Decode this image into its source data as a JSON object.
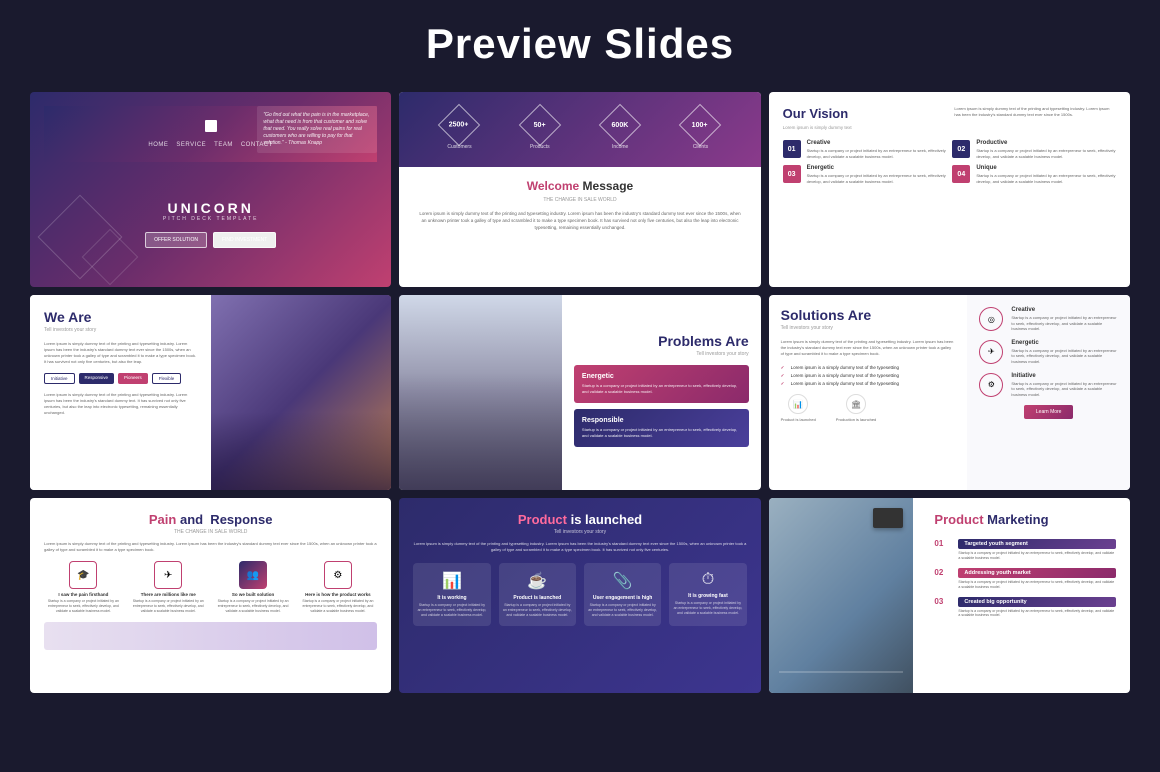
{
  "page": {
    "title": "Preview Slides",
    "background": "#1a1a2e"
  },
  "slides": [
    {
      "id": "slide-1",
      "type": "unicorn",
      "brand": "UNICORN",
      "subtitle": "PITCH DECK TEMPLATE",
      "quote": "\"Go find out what the pain is in the marketplace, what that need is from that customer and solve that need. You really solve real pains for real customers who are willing to pay for that solution.\" - Thomas Knapp",
      "nav": [
        "HOME",
        "SERVICE",
        "TEAM",
        "CONTACT"
      ],
      "btn1": "OFFER SOLUTION",
      "btn2": "FIND INVESTMENT"
    },
    {
      "id": "slide-2",
      "type": "welcome",
      "stats": [
        {
          "num": "2500+",
          "label": "Customers"
        },
        {
          "num": "50+",
          "label": "Products"
        },
        {
          "num": "600K",
          "label": "Income"
        },
        {
          "num": "100+",
          "label": "Clients"
        }
      ],
      "title": "Welcome Message",
      "title_highlight": "Welcome",
      "subtitle": "THE CHANGE IN SALE WORLD",
      "desc": "Lorem ipsum is simply dummy text of the printing and typesetting industry. Lorem ipsum has been the industry's standard dummy text ever since the 1500s, when an unknown printer took a galley of type and scrambled it to make a type specimen book. It has survived not only five centuries, but also the leap into electronic typesetting, remaining essentially unchanged."
    },
    {
      "id": "slide-3",
      "type": "vision",
      "title": "Our Vision",
      "items": [
        {
          "num": "01",
          "label": "Creative",
          "desc": "Startup is a company or project initiated by an entrepreneur to seek, effectively develop, and validate a scalable business model."
        },
        {
          "num": "02",
          "label": "Productive",
          "desc": "Startup is a company or project initiated by an entrepreneur to seek, effectively develop, and validate a scalable business model."
        },
        {
          "num": "03",
          "label": "Energetic",
          "desc": "Startup is a company or project initiated by an entrepreneur to seek, effectively develop, and validate a scalable business model."
        },
        {
          "num": "04",
          "label": "Unique",
          "desc": "Startup is a company or project initiated by an entrepreneur to seek, effectively develop, and validate a scalable business model."
        }
      ]
    },
    {
      "id": "slide-4",
      "type": "we-are",
      "title": "We Are",
      "subtitle": "Tell investors your story",
      "desc": "Lorem ipsum is simply dummy text of the printing and typesetting industry.",
      "tags": [
        "Initiative",
        "Responsive",
        "Pioneers",
        "Flexible"
      ]
    },
    {
      "id": "slide-5",
      "type": "problems",
      "title": "Problems Are",
      "subtitle": "Tell investors your story",
      "cards": [
        {
          "title": "Energetic",
          "desc": "Startup is a company or project initiated by an entrepreneur to seek, effectively develop, and validate a scalable business model.",
          "style": "pink"
        },
        {
          "title": "Responsible",
          "desc": "Startup is a company or project initiated by an entrepreneur to seek, effectively develop, and validate a scalable business model.",
          "style": "dark"
        }
      ]
    },
    {
      "id": "slide-6",
      "type": "solutions",
      "title": "Solutions Are",
      "subtitle": "Tell investors your story",
      "checklist": [
        "Lorem ipsum is a simply dummy text of the typesetting",
        "Lorem ipsum is a simply dummy text of the typesetting",
        "Lorem ipsum is a simply dummy text of the typesetting"
      ],
      "items": [
        {
          "icon": "◎",
          "title": "Creative",
          "desc": "Startup is a company or project initiated by an entrepreneur to seek, effectively develop, and validate a scalable business model."
        },
        {
          "icon": "✈",
          "title": "Energetic",
          "desc": "Startup is a company or project initiated by an entrepreneur to seek, effectively develop, and validate a scalable business model."
        },
        {
          "icon": "⚙",
          "title": "Initiative",
          "desc": "Startup is a company or project initiated by an entrepreneur to seek, effectively develop, and validate a scalable business model."
        }
      ],
      "learn_btn": "Learn More",
      "bottom_icons": [
        {
          "icon": "📊",
          "label": "Product is launched"
        },
        {
          "icon": "🏛",
          "label": "Production is launched"
        }
      ]
    },
    {
      "id": "slide-7",
      "type": "pain",
      "title": "Pain and  Response",
      "title_highlight": "Pain",
      "subtitle": "THE CHANGE IN SALE WORLD",
      "desc": "Lorem ipsum is simply dummy text of the printing and typesetting industry. Lorem ipsum has been the industry's standard dummy text ever since the 1500s, when an unknown printer took a galley of type and scrambled it to make a type specimen book.",
      "steps": [
        {
          "icon": "🎓",
          "label": "I saw the pain firsthand",
          "desc": "Startup is a company or project initiated by an entrepreneur to seek, effectively develop, and validate a scalable business model."
        },
        {
          "icon": "✈",
          "label": "There are millions like me",
          "desc": "Startup is a company or project initiated by an entrepreneur to seek, effectively develop, and validate a scalable business model."
        },
        {
          "icon": "👥",
          "label": "So we built solution",
          "desc": "Startup is a company or project initiated by an entrepreneur to seek, effectively develop, and validate a scalable business model.",
          "active": true
        },
        {
          "icon": "⚙",
          "label": "Here is how the product works",
          "desc": "Startup is a company or project initiated by an entrepreneur to seek, effectively develop, and validate a scalable business model."
        }
      ]
    },
    {
      "id": "slide-8",
      "type": "launched",
      "title": "Product is launched",
      "title_highlight": "Product",
      "subtitle": "Tell investors your story",
      "desc": "Lorem ipsum is simply dummy text of the printing and typesetting industry. Lorem ipsum has been the industry's standard dummy text ever since the 1500s, when an unknown printer took a galley of type and scrambled it to make a type specimen book. It has survived not only five centuries.",
      "items": [
        {
          "icon": "📊",
          "label": "It is working",
          "desc": "Startup is a company or project initiated by an entrepreneur to seek, effectively develop, and validate a scalable business model."
        },
        {
          "icon": "☕",
          "label": "Product is launched",
          "desc": "Startup is a company or project initiated by an entrepreneur to seek, effectively develop, and validate a scalable business model."
        },
        {
          "icon": "📎",
          "label": "User engagement is high",
          "desc": "Startup is a company or project initiated by an entrepreneur to seek, effectively develop, and validate a scalable business model."
        },
        {
          "icon": "⏱",
          "label": "It is growing fast",
          "desc": "Startup is a company or project initiated by an entrepreneur to seek, effectively develop, and validate a scalable business model."
        }
      ]
    },
    {
      "id": "slide-9",
      "type": "marketing",
      "title": "Product Marketing",
      "title_highlight": "Product",
      "items": [
        {
          "num": "01",
          "label": "Targeted youth segment",
          "desc": "Startup is a company or project initiated by an entrepreneur to seek, effectively develop, and validate a scalable business model."
        },
        {
          "num": "02",
          "label": "Addressing youth market",
          "desc": "Startup is a company or project initiated by an entrepreneur to seek, effectively develop, and validate a scalable business model."
        },
        {
          "num": "03",
          "label": "Created big opportunity",
          "desc": "Startup is a company or project initiated by an entrepreneur to seek, effectively develop, and validate a scalable business model."
        }
      ]
    }
  ]
}
